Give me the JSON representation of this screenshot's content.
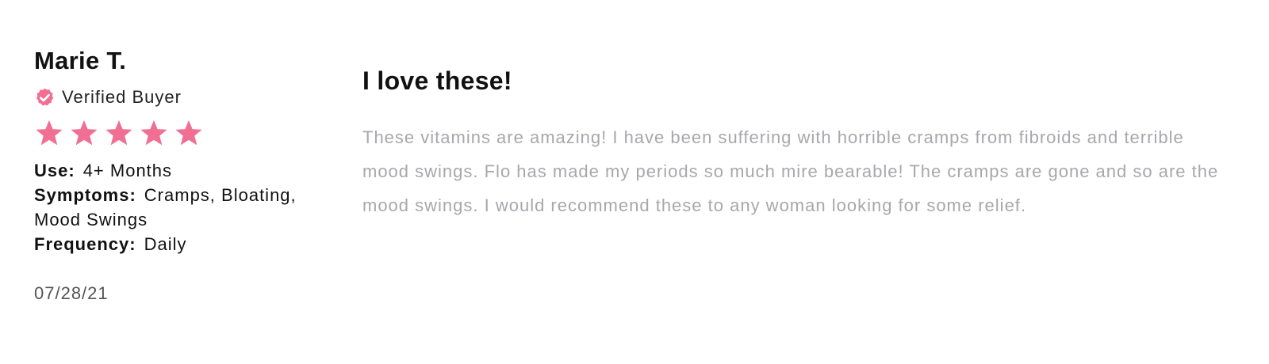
{
  "review": {
    "reviewer_name": "Marie T.",
    "verified": {
      "label": "Verified Buyer",
      "icon": "verified-badge-icon",
      "color": "#f06f93"
    },
    "rating": {
      "value": 5,
      "max": 5,
      "icon": "star-icon",
      "color": "#f06f93"
    },
    "details": [
      {
        "key": "Use:",
        "value": "4+ Months"
      },
      {
        "key": "Symptoms:",
        "value": "Cramps, Bloating, Mood Swings"
      },
      {
        "key": "Frequency:",
        "value": "Daily"
      }
    ],
    "date": "07/28/21",
    "title": "I love these!",
    "body": "These vitamins are amazing! I have been suffering with horrible cramps from fibroids and terrible mood swings. Flo has made my periods so much mire bearable! The cramps are gone and so are the mood swings. I would recommend these to any woman looking for some relief."
  },
  "colors": {
    "accent": "#f06f93",
    "body_text": "#a7a7ad",
    "heading_text": "#111111"
  }
}
